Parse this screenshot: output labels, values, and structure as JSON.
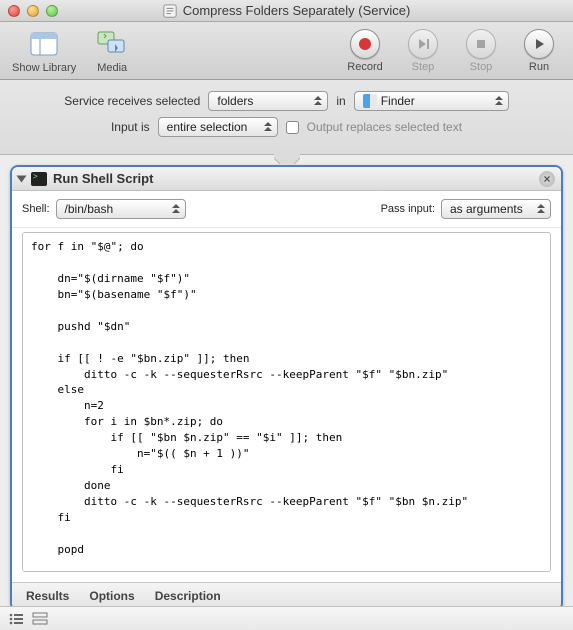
{
  "window": {
    "title": "Compress Folders Separately (Service)"
  },
  "toolbar": {
    "show_library": "Show Library",
    "media": "Media",
    "record": "Record",
    "step": "Step",
    "stop": "Stop",
    "run": "Run"
  },
  "config": {
    "receives_label": "Service receives selected",
    "receives_value": "folders",
    "in_label": "in",
    "app_value": "Finder",
    "input_is_label": "Input is",
    "input_is_value": "entire selection",
    "replaces_label": "Output replaces selected text"
  },
  "action": {
    "title": "Run Shell Script",
    "shell_label": "Shell:",
    "shell_value": "/bin/bash",
    "pass_input_label": "Pass input:",
    "pass_input_value": "as arguments",
    "script": "for f in \"$@\"; do\n\n    dn=\"$(dirname \"$f\")\"\n    bn=\"$(basename \"$f\")\"\n\n    pushd \"$dn\"\n\n    if [[ ! -e \"$bn.zip\" ]]; then\n        ditto -c -k --sequesterRsrc --keepParent \"$f\" \"$bn.zip\"\n    else\n        n=2\n        for i in $bn*.zip; do\n            if [[ \"$bn $n.zip\" == \"$i\" ]]; then\n                n=\"$(( $n + 1 ))\"\n            fi\n        done\n        ditto -c -k --sequesterRsrc --keepParent \"$f\" \"$bn $n.zip\"\n    fi\n\n    popd\n\ndone\n\nafplay /System/Library/Sounds/Purr.aiff",
    "tabs": {
      "results": "Results",
      "options": "Options",
      "description": "Description"
    }
  }
}
